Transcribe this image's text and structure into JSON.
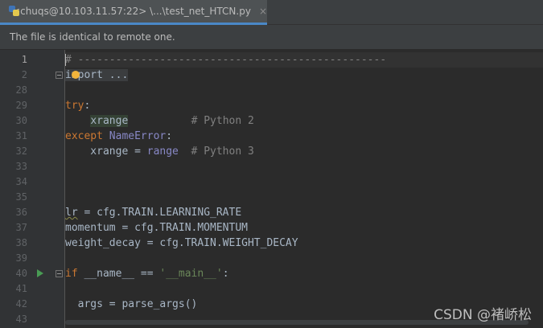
{
  "tab": {
    "title": "<chuqs@10.103.11.57:22> \\...\\test_net_HTCN.py",
    "icon": "python-file-icon",
    "close_glyph": "×"
  },
  "banner": {
    "text": "The file is identical to remote one."
  },
  "editor": {
    "lines": [
      {
        "num": "1",
        "code": "# -------------------------------------------------"
      },
      {
        "num": "2",
        "code": "import ..."
      },
      {
        "num": "28",
        "code": ""
      },
      {
        "num": "29",
        "code": "try:"
      },
      {
        "num": "30",
        "code": "    xrange          # Python 2"
      },
      {
        "num": "31",
        "code": "except NameError:"
      },
      {
        "num": "32",
        "code": "    xrange = range  # Python 3"
      },
      {
        "num": "33",
        "code": ""
      },
      {
        "num": "34",
        "code": ""
      },
      {
        "num": "35",
        "code": ""
      },
      {
        "num": "36",
        "code": "lr = cfg.TRAIN.LEARNING_RATE"
      },
      {
        "num": "37",
        "code": "momentum = cfg.TRAIN.MOMENTUM"
      },
      {
        "num": "38",
        "code": "weight_decay = cfg.TRAIN.WEIGHT_DECAY"
      },
      {
        "num": "39",
        "code": ""
      },
      {
        "num": "40",
        "code": "if __name__ == '__main__':"
      },
      {
        "num": "41",
        "code": ""
      },
      {
        "num": "42",
        "code": "  args = parse_args()"
      },
      {
        "num": "43",
        "code": ""
      }
    ]
  },
  "watermark": "CSDN @褚峤松",
  "colors": {
    "keyword": "#cc7832",
    "builtin": "#8888c6",
    "comment": "#808080",
    "string": "#6a8759",
    "text": "#a9b7c6",
    "background": "#2b2b2b"
  }
}
